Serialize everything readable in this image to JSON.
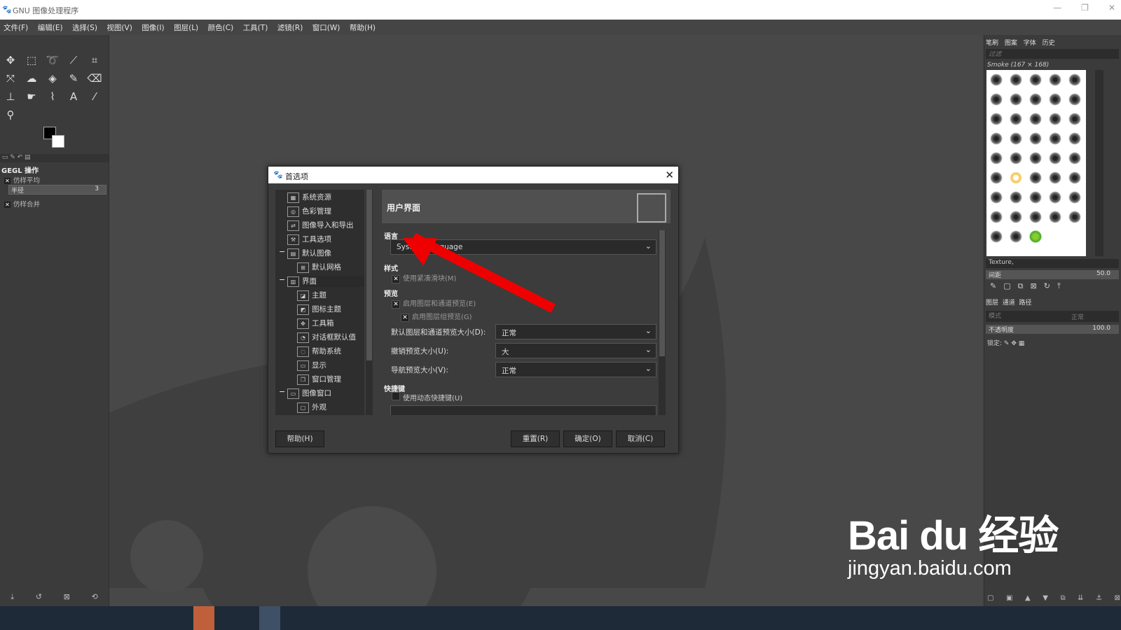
{
  "window": {
    "title": "GNU 图像处理程序",
    "controls": [
      "—",
      "❐",
      "✕"
    ]
  },
  "menu": [
    "文件(F)",
    "编辑(E)",
    "选择(S)",
    "视图(V)",
    "图像(I)",
    "图层(L)",
    "颜色(C)",
    "工具(T)",
    "滤镜(R)",
    "窗口(W)",
    "帮助(H)"
  ],
  "left_dock": {
    "panel_title": "GEGL 操作",
    "option1": "仿样平均",
    "radius_label": "半径",
    "radius_value": "3",
    "option2": "仿样合并"
  },
  "dialog": {
    "title": "首选项",
    "close": "✕",
    "tree": [
      {
        "label": "系统资源",
        "level": 1,
        "icon": "sysres-icon"
      },
      {
        "label": "色彩管理",
        "level": 1,
        "icon": "color-icon"
      },
      {
        "label": "图像导入和导出",
        "level": 1,
        "icon": "import-icon"
      },
      {
        "label": "工具选项",
        "level": 1,
        "icon": "toolopt-icon"
      },
      {
        "label": "默认图像",
        "level": 1,
        "icon": "defimg-icon",
        "expander": "−"
      },
      {
        "label": "默认网格",
        "level": 2,
        "icon": "grid-icon"
      },
      {
        "label": "界面",
        "level": 1,
        "icon": "interface-icon",
        "expander": "−",
        "selected": true
      },
      {
        "label": "主题",
        "level": 2,
        "icon": "theme-icon"
      },
      {
        "label": "图标主题",
        "level": 2,
        "icon": "icontheme-icon"
      },
      {
        "label": "工具箱",
        "level": 2,
        "icon": "toolbox-icon"
      },
      {
        "label": "对话框默认值",
        "level": 2,
        "icon": "dialog-icon"
      },
      {
        "label": "帮助系统",
        "level": 2,
        "icon": "help-icon"
      },
      {
        "label": "显示",
        "level": 2,
        "icon": "display-icon"
      },
      {
        "label": "窗口管理",
        "level": 2,
        "icon": "window-icon"
      },
      {
        "label": "图像窗口",
        "level": 1,
        "icon": "imgwin-icon",
        "expander": "−"
      },
      {
        "label": "外观",
        "level": 2,
        "icon": "appearance-icon"
      }
    ],
    "banner_title": "用户界面",
    "lang_section": "语言",
    "lang_value": "System Language",
    "style_section": "样式",
    "style_cb": "使用紧凑滑块(M)",
    "preview_section": "预览",
    "preview_cb1": "启用图层和通道预览(E)",
    "preview_cb2": "启用图层组预览(G)",
    "field1_label": "默认图层和通道预览大小(D):",
    "field1_value": "正常",
    "field2_label": "撤销预览大小(U):",
    "field2_value": "大",
    "field3_label": "导航预览大小(V):",
    "field3_value": "正常",
    "shortcut_section": "快捷键",
    "shortcut_cb": "使用动态快捷键(U)",
    "btn_help": "帮助(H)",
    "btn_reset": "重置(R)",
    "btn_ok": "确定(O)",
    "btn_cancel": "取消(C)"
  },
  "right_dock": {
    "tabs": [
      "笔刷",
      "图案",
      "字体",
      "历史"
    ],
    "filter_placeholder": "过滤",
    "brush_name": "Smoke (167 × 168)",
    "tag": "Texture,",
    "spacing_label": "间距",
    "spacing_value": "50.0",
    "layer_tabs": [
      "图层",
      "通道",
      "路径"
    ],
    "mode_label": "模式",
    "mode_value": "正常",
    "opacity_label": "不透明度",
    "opacity_value": "100.0",
    "lock_label": "锁定:"
  },
  "watermark": {
    "line1": "Bai du 经验",
    "line2": "jingyan.baidu.com"
  }
}
